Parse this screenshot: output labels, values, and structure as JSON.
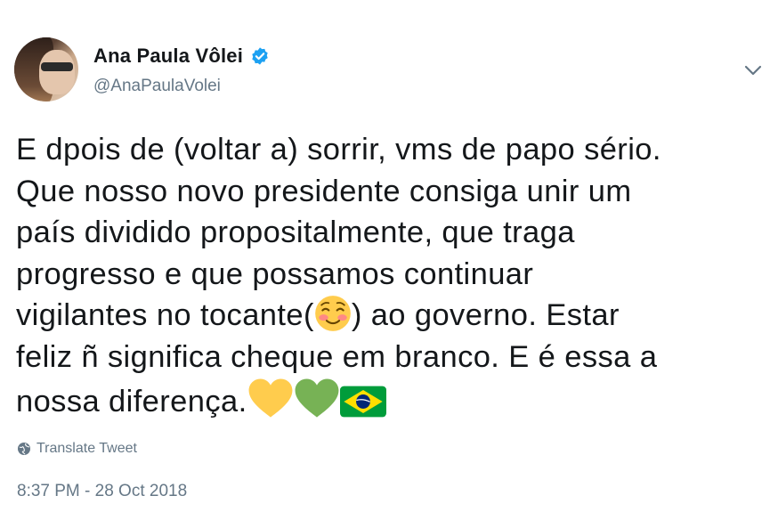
{
  "author": {
    "display_name": "Ana Paula Vôlei",
    "handle": "@AnaPaulaVolei",
    "verified": true
  },
  "tweet": {
    "lines": [
      "E dpois de (voltar a) sorrir, vms de papo sério.",
      "Que nosso novo presidente consiga unir um",
      "país dividido propositalmente, que traga",
      "progresso e que possamos continuar",
      "vigilantes no tocante(",
      ") ao governo. Estar",
      "feliz ñ significa cheque em branco. E é essa a",
      "nossa diferença."
    ],
    "emojis": [
      "smiling-face-emoji",
      "yellow-heart-emoji",
      "green-heart-emoji",
      "brazil-flag-emoji"
    ]
  },
  "actions": {
    "translate_label": "Translate Tweet"
  },
  "meta": {
    "timestamp": "8:37 PM - 28 Oct 2018"
  },
  "colors": {
    "text": "#14171a",
    "secondary": "#657786",
    "verified_blue": "#1da1f2",
    "yellow_heart": "#ffcc4d",
    "green_heart": "#77b255"
  }
}
